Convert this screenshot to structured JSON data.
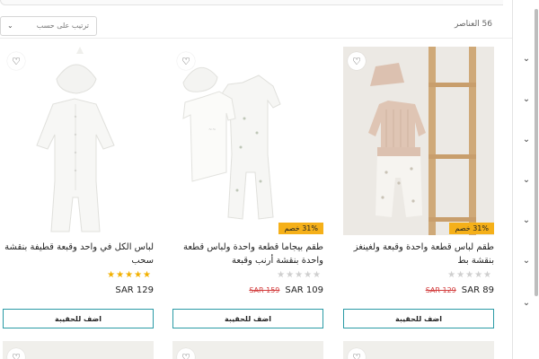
{
  "toolbar": {
    "sort_placeholder": "ترتيب على حسب",
    "item_count": "56 العناصر"
  },
  "products": [
    {
      "title": "طقم لباس قطعة واحدة وقبعة ولغينغز بنقشة بط",
      "discount": "31% خصم",
      "rating_filled": 0,
      "rating_max": 5,
      "price_now": "SAR 89",
      "price_old": "SAR 129",
      "button_label": "اضف للحقيبة"
    },
    {
      "title": "طقم بيجاما قطعة واحدة ولباس قطعة واحدة بنقشة أرنب وقبعة",
      "discount": "31% خصم",
      "rating_filled": 0,
      "rating_max": 5,
      "price_now": "SAR 109",
      "price_old": "SAR 159",
      "button_label": "اضف للحقيبة"
    },
    {
      "title": "لباس الكل في واحد وقبعة قطيفة بنقشة سحب",
      "discount": "",
      "rating_filled": 5,
      "rating_max": 5,
      "price_now": "SAR 129",
      "price_old": "",
      "button_label": "اضف للحقيبة"
    }
  ],
  "icons": {
    "favorite": "heart-outline-icon",
    "chevron": "chevron-down-icon"
  },
  "colors": {
    "accent_border": "#2a9aa5",
    "discount_badge": "#f5b019",
    "old_price": "#d23b3b",
    "star": "#f2b000"
  }
}
